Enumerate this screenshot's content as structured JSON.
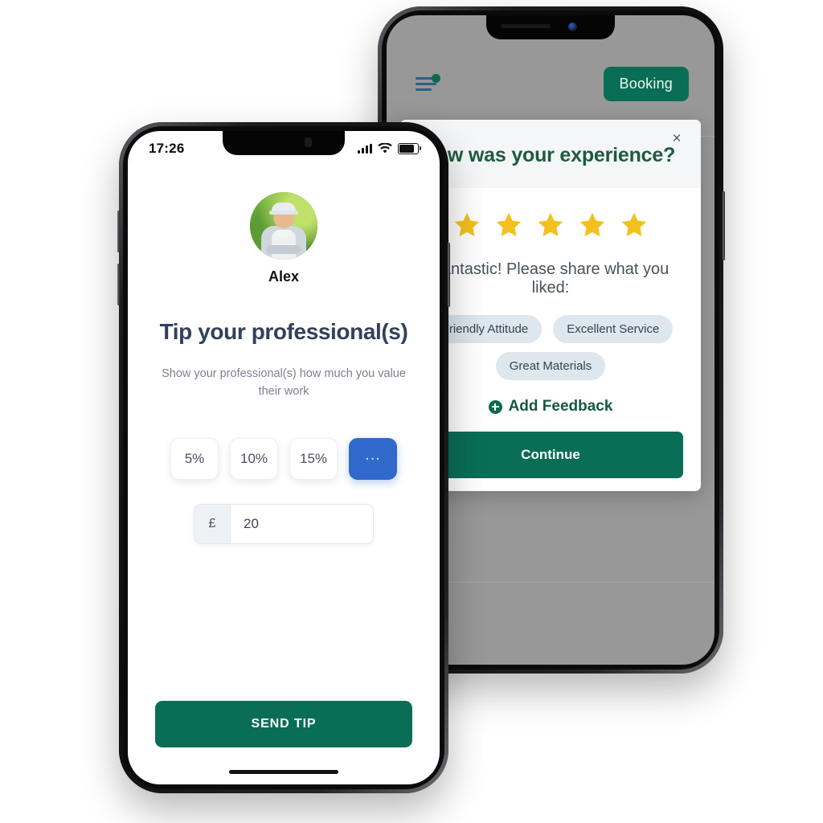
{
  "back_phone": {
    "topbar": {
      "menu_icon": "hamburger-menu-icon",
      "menu_badge": "notification-dot",
      "booking_label": "Booking"
    },
    "modal": {
      "title": "How was your experience?",
      "close_icon": "×",
      "rating": {
        "value": 5,
        "max": 5,
        "star_icon": "star-icon",
        "color": "#f4c01f"
      },
      "share_prompt": "Fantastic! Please share what you liked:",
      "chips": [
        "Friendly Attitude",
        "Excellent Service",
        "Great Materials"
      ],
      "add_feedback_label": "Add Feedback",
      "add_feedback_icon": "plus-circle-icon",
      "continue_label": "Continue"
    }
  },
  "front_phone": {
    "status_bar": {
      "time": "17:26",
      "signal_icon": "cellular-signal-icon",
      "wifi_icon": "wifi-icon",
      "battery_icon": "battery-icon"
    },
    "professional": {
      "avatar_icon": "professional-avatar",
      "name": "Alex"
    },
    "tip": {
      "title": "Tip your professional(s)",
      "subtitle": "Show your professional(s) how much you value their work",
      "options": [
        "5%",
        "10%",
        "15%"
      ],
      "more_label": "...",
      "currency_symbol": "£",
      "amount": "20",
      "send_label": "SEND TIP"
    }
  },
  "colors": {
    "brand_green": "#0a6e56",
    "modal_title_green": "#1d5c3d",
    "accent_blue": "#3069ca",
    "star_yellow": "#f4c01f",
    "chip_bg": "#dee6ee",
    "heading_navy": "#33405a"
  }
}
